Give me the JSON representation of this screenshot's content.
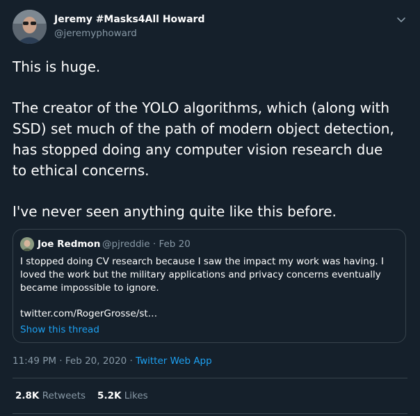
{
  "author": {
    "name": "Jeremy #Masks4All Howard",
    "handle": "@jeremyphoward"
  },
  "tweet": {
    "lines": [
      "This is huge.",
      "The creator of the YOLO algorithms, which (along with",
      "SSD) set much of the path of modern object detection,",
      "has stopped doing any computer vision research due",
      "to ethical concerns.",
      "I've never seen anything quite like this before."
    ]
  },
  "quote": {
    "name": "Joe Redmon",
    "handle": "@pjreddie",
    "date": "Feb 20",
    "lines": [
      "I stopped doing CV research because I saw the impact my work was having. I",
      "loved the work but the military applications and privacy concerns eventually",
      "became impossible to ignore."
    ],
    "link": "twitter.com/RogerGrosse/st…",
    "show_thread": "Show this thread"
  },
  "meta": {
    "time": "11:49 PM",
    "date": "Feb 20, 2020",
    "source": "Twitter Web App"
  },
  "stats": {
    "retweets": "2.8K",
    "retweets_label": "Retweets",
    "likes": "5.2K",
    "likes_label": "Likes"
  },
  "colors": {
    "background": "#15202b",
    "accent": "#1da1f2",
    "secondary_text": "#8899a6",
    "border": "#38444d"
  },
  "icons": {
    "caret": "chevron-down-icon"
  }
}
